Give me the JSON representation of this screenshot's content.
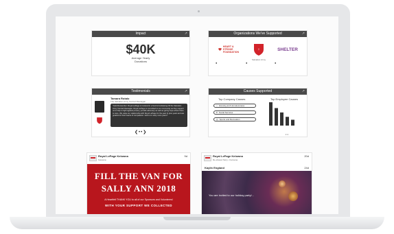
{
  "impact": {
    "title": "Impact",
    "value": "$40K",
    "caption_1": "Average Yearly",
    "caption_2": "Donations"
  },
  "organizations": {
    "title": "Organizations We've Supported",
    "items": [
      {
        "name": "",
        "logo_text_1": "HEART &",
        "logo_text_2": "STROKE",
        "logo_text_3": "FOUNDATION"
      },
      {
        "name": "Salvation Army",
        "logo_text": ""
      },
      {
        "name": "",
        "logo_text": "SHELTER"
      }
    ]
  },
  "testimonials": {
    "title": "Testimonials",
    "name": "Tamara Rotalo",
    "role": "The Salvation Army Central Okanagan",
    "quote": "\"Gold Remember: Royal LePage is involved in a food & fundraising Fill the Salvation Army Central Okanagan. Royal LePage is committed to our community as they support us to help to fight against poverty, provide advocacy as well as giving hope where there is none. We value our relationship with Royal LePage for the past 11 plus years and are grateful for their hearts of compassion. Here's to many more years!\""
  },
  "causes": {
    "title": "Causes Supported",
    "company_heading": "Top Company Causes",
    "employee_heading": "Top Employee Causes",
    "company_causes": [
      "Housing and Homelessness",
      "Social Services",
      "Sports and Recreation"
    ],
    "employee_bars": [
      32,
      24,
      18,
      12,
      8
    ]
  },
  "posts": [
    {
      "author": "Royal LePage Kelowna",
      "location": "Kelowna",
      "time": "9d",
      "line_1": "FILL THE VAN FOR",
      "line_2": "SALLY ANN 2018",
      "line_3": "A Heartfelt THANK YOU to all of our Sponsors and Volunteers!",
      "line_4": "WITH YOUR SUPPORT WE COLLECTED"
    },
    {
      "author": "Royal LePage Kelowna",
      "location": "Re-shared Story • Kelowna",
      "time": "20d",
      "shared_author": "Kaylin England",
      "shared_time": "24d",
      "text": "You are invited to our holiday party!..."
    }
  ],
  "colors": {
    "header": "#4a4a4a",
    "brand_red": "#d2232a",
    "banner_red": "#b8161d"
  }
}
